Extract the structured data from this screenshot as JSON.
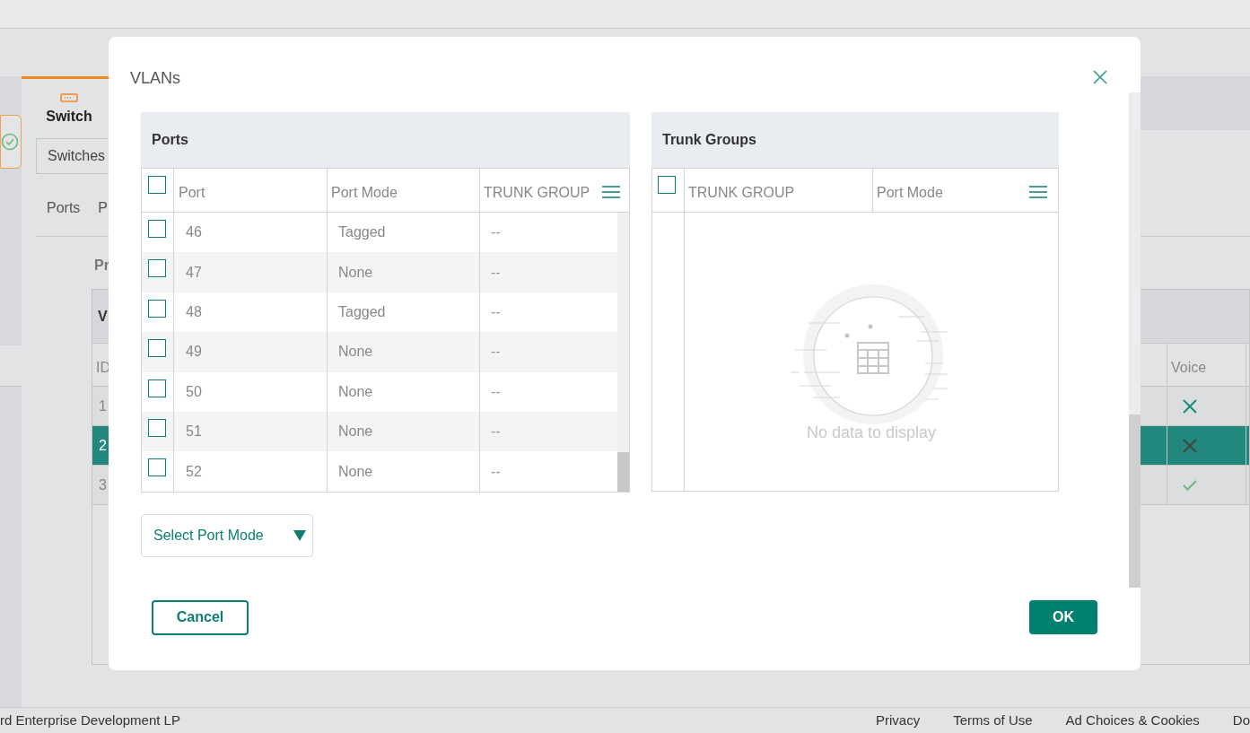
{
  "background": {
    "nav_title": "Switch",
    "switch_select": "Switches",
    "tab_labels": [
      "Ports",
      "P"
    ],
    "section_title": "Pr",
    "table": {
      "title": "V",
      "columns": [
        "ID",
        "Voice"
      ],
      "rows": [
        {
          "id": "1",
          "voice": false,
          "selected": false
        },
        {
          "id": "2",
          "voice": false,
          "selected": true
        },
        {
          "id": "3",
          "voice": true,
          "selected": false
        }
      ]
    }
  },
  "dialog": {
    "title": "VLANs",
    "ports": {
      "title": "Ports",
      "select_all": false,
      "columns": [
        "Port",
        "Port Mode",
        "TRUNK GROUP"
      ],
      "rows": [
        {
          "port": "46",
          "mode": "Tagged",
          "trunk": "--",
          "checked": false
        },
        {
          "port": "47",
          "mode": "None",
          "trunk": "--",
          "checked": false
        },
        {
          "port": "48",
          "mode": "Tagged",
          "trunk": "--",
          "checked": false
        },
        {
          "port": "49",
          "mode": "None",
          "trunk": "--",
          "checked": false
        },
        {
          "port": "50",
          "mode": "None",
          "trunk": "--",
          "checked": false
        },
        {
          "port": "51",
          "mode": "None",
          "trunk": "--",
          "checked": false
        },
        {
          "port": "52",
          "mode": "None",
          "trunk": "--",
          "checked": false
        }
      ]
    },
    "trunk_groups": {
      "title": "Trunk Groups",
      "select_all": false,
      "columns": [
        "TRUNK GROUP",
        "Port Mode"
      ],
      "empty_text": "No data to display"
    },
    "port_mode_select": {
      "placeholder": "Select Port Mode"
    },
    "buttons": {
      "cancel": "Cancel",
      "ok": "OK"
    }
  },
  "footer": {
    "copyright": "rd Enterprise Development LP",
    "links": [
      "Privacy",
      "Terms of Use",
      "Ad Choices & Cookies",
      "Do"
    ]
  }
}
